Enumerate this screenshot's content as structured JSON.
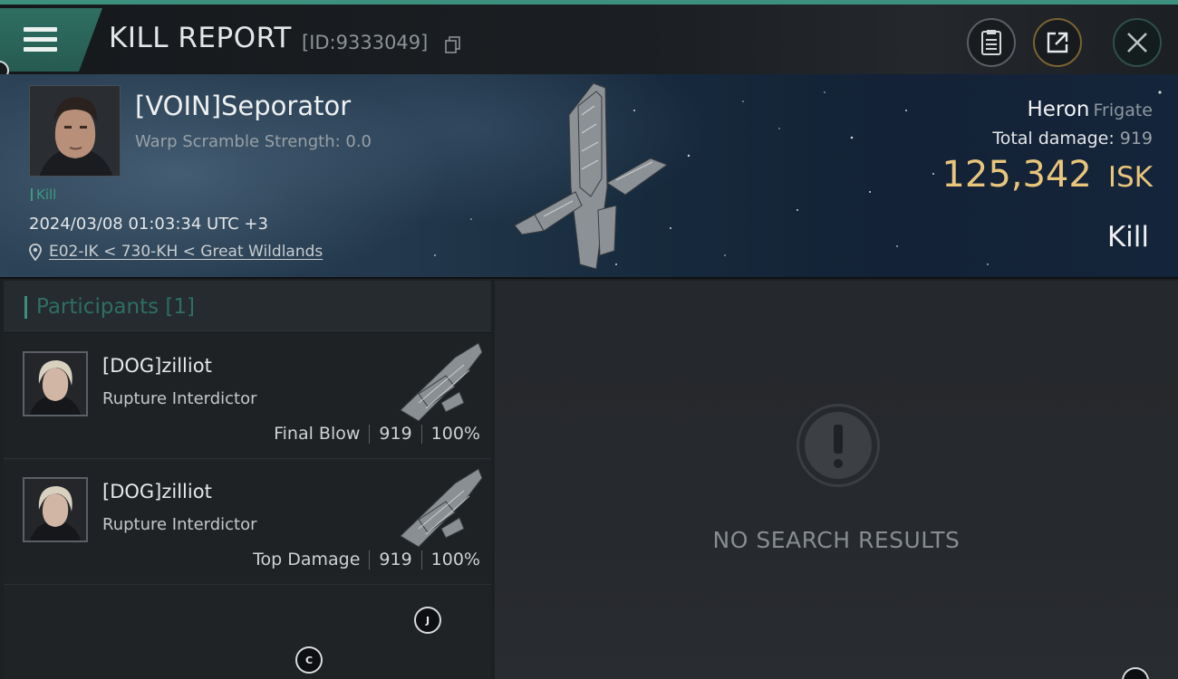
{
  "header": {
    "title": "KILL REPORT",
    "report_id": "[ID:9333049]"
  },
  "victim": {
    "name": "[VOIN]Seporator",
    "warp_scramble": "Warp Scramble Strength: 0.0",
    "tag": "Kill",
    "datetime": "2024/03/08 01:03:34 UTC +3",
    "location": "E02-IK < 730-KH < Great Wildlands"
  },
  "ship": {
    "name": "Heron",
    "class": "Frigate",
    "total_damage_label": "Total damage:",
    "total_damage_value": "919",
    "isk_value": "125,342",
    "isk_unit": "ISK",
    "result": "Kill"
  },
  "participants": {
    "header": "Participants [1]",
    "rows": [
      {
        "name": "[DOG]zilliot",
        "ship": "Rupture Interdictor",
        "role": "Final Blow",
        "damage": "919",
        "percent": "100%"
      },
      {
        "name": "[DOG]zilliot",
        "ship": "Rupture Interdictor",
        "role": "Top Damage",
        "damage": "919",
        "percent": "100%"
      }
    ]
  },
  "results": {
    "empty_text": "NO SEARCH RESULTS"
  },
  "floating_markers": {
    "marker_j": "J",
    "marker_c": "C"
  },
  "icons": {
    "menu": "hamburger-menu-icon",
    "copy": "copy-icon",
    "clipboard": "clipboard-icon",
    "share": "share-icon",
    "close": "close-icon",
    "location": "location-pin-icon",
    "warning": "exclamation-icon"
  },
  "colors": {
    "accent": "#3d8f7e",
    "isk": "#e8c57a",
    "share_ring": "#7a6331"
  }
}
